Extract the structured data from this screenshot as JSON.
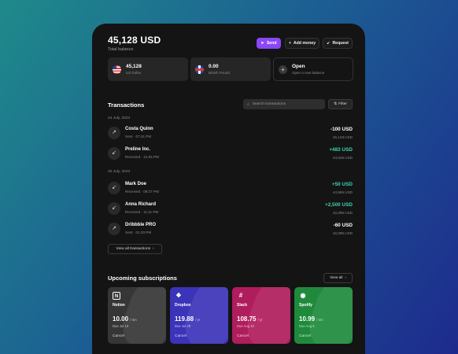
{
  "header": {
    "total": "45,128 USD",
    "total_label": "Total balance",
    "buttons": [
      {
        "label": "Send",
        "icon": "send-icon"
      },
      {
        "label": "Add money",
        "icon": "plus-icon"
      },
      {
        "label": "Request",
        "icon": "request-icon"
      }
    ]
  },
  "balances": [
    {
      "amount": "45,128",
      "currency": "US Dollar",
      "flag": "us-flag-icon"
    },
    {
      "amount": "0.00",
      "currency": "British Pound",
      "flag": "uk-flag-icon"
    },
    {
      "amount": "Open",
      "currency": "Open a new balance",
      "icon": "plus-icon"
    }
  ],
  "transactions": {
    "title": "Transactions",
    "search_placeholder": "Search transactions",
    "filter_label": "Filter",
    "groups": [
      {
        "date": "24 July, 2023"
      },
      {
        "date": "20 July, 2023"
      }
    ],
    "items": [
      {
        "name": "Costa Quinn",
        "meta": "Sent · 07:41 PM",
        "amount": "-100 USD",
        "balance": "45,128 USD",
        "direction": "out"
      },
      {
        "name": "Preline Inc.",
        "meta": "Received · 12:05 PM",
        "amount": "+483 USD",
        "balance": "44,645 USD",
        "direction": "in"
      },
      {
        "name": "Mark Doe",
        "meta": "Received · 09:27 PM",
        "amount": "+50 USD",
        "balance": "44,595 USD",
        "direction": "in"
      },
      {
        "name": "Anna Richard",
        "meta": "Received · 11:11 PM",
        "amount": "+2,500 USD",
        "balance": "42,095 USD",
        "direction": "in"
      },
      {
        "name": "Dribbble PRO",
        "meta": "Sent · 01:20 PM",
        "amount": "-60 USD",
        "balance": "42,095 USD",
        "direction": "out"
      }
    ],
    "view_all": "View all transactions"
  },
  "subscriptions": {
    "title": "Upcoming subscriptions",
    "view_all": "View all",
    "items": [
      {
        "name": "Notion",
        "price": "10.00",
        "period": "/ mn",
        "due": "Due Jul 13",
        "cancel": "Cancel",
        "color": "#3a3a3a",
        "logo": "N"
      },
      {
        "name": "Dropbox",
        "price": "119.88",
        "period": "/ yr",
        "due": "Due Jul 29",
        "cancel": "Cancel",
        "color": "#3b33b8",
        "logo": "❖"
      },
      {
        "name": "Slack",
        "price": "108.75",
        "period": "/ yr",
        "due": "Due Aug 10",
        "cancel": "Cancel",
        "color": "#b01d5c",
        "logo": "#"
      },
      {
        "name": "Spotify",
        "price": "10.99",
        "period": "/ mn",
        "due": "Due Aug 5",
        "cancel": "Cancel",
        "color": "#1f8a3c",
        "logo": "◉"
      }
    ]
  }
}
